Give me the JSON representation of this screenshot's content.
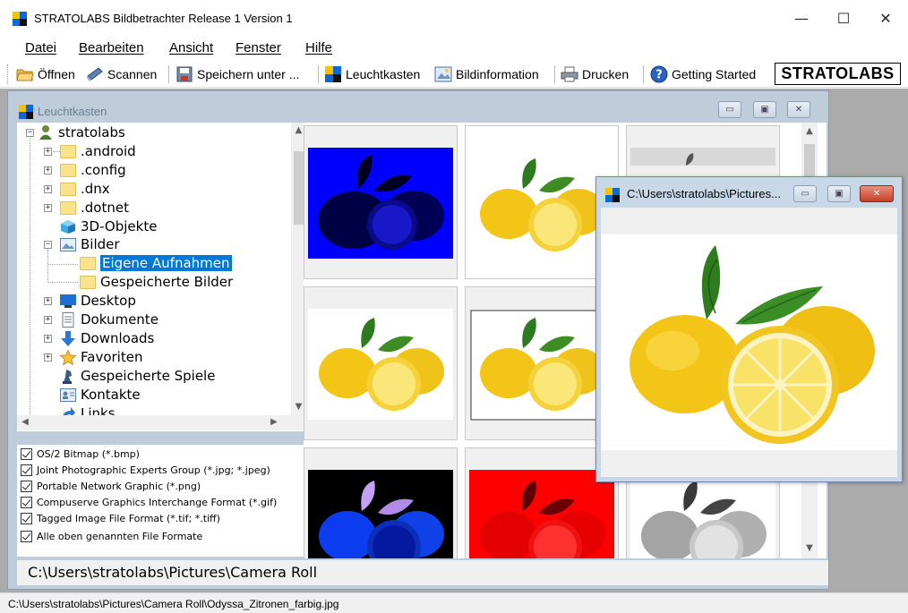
{
  "app": {
    "title": "STRATOLABS Bildbetrachter Release 1 Version 1",
    "controls": {
      "minimize": "—",
      "maximize": "☐",
      "close": "✕"
    }
  },
  "menu": [
    "Datei",
    "Bearbeiten",
    "Ansicht",
    "Fenster",
    "Hilfe"
  ],
  "toolbar": {
    "open": "Öffnen",
    "scan": "Scannen",
    "save_as": "Speichern unter ...",
    "lightbox": "Leuchtkasten",
    "image_info": "Bildinformation",
    "print": "Drucken",
    "getting_started": "Getting Started",
    "brand": "STRATOLABS"
  },
  "lightbox_window": {
    "title": "Leuchtkasten",
    "tree": {
      "root": "stratolabs",
      "items": [
        ".android",
        ".config",
        ".dnx",
        ".dotnet",
        "3D-Objekte",
        "Bilder",
        "Eigene Aufnahmen",
        "Gespeicherte Bilder",
        "Desktop",
        "Dokumente",
        "Downloads",
        "Favoriten",
        "Gespeicherte Spiele",
        "Kontakte",
        "Links"
      ],
      "selected": "Eigene Aufnahmen"
    },
    "filters": [
      "OS/2 Bitmap (*.bmp)",
      "Joint Photographic Experts Group (*.jpg; *.jpeg)",
      "Portable Network Graphic (*.png)",
      "Compuserve Graphics Interchange Format (*.gif)",
      "Tagged Image File Format (*.tif; *.tiff)",
      "Alle oben genannten File Formate"
    ],
    "path": "C:\\Users\\stratolabs\\Pictures\\Camera Roll"
  },
  "image_window": {
    "title": "C:\\Users\\stratolabs\\Pictures..."
  },
  "status": "C:\\Users\\stratolabs\\Pictures\\Camera Roll\\Odyssa_Zitronen_farbig.jpg",
  "colors": {
    "selection": "#0078d7",
    "mdi_background": "#ababab",
    "child_frame": "#bfcddb"
  }
}
